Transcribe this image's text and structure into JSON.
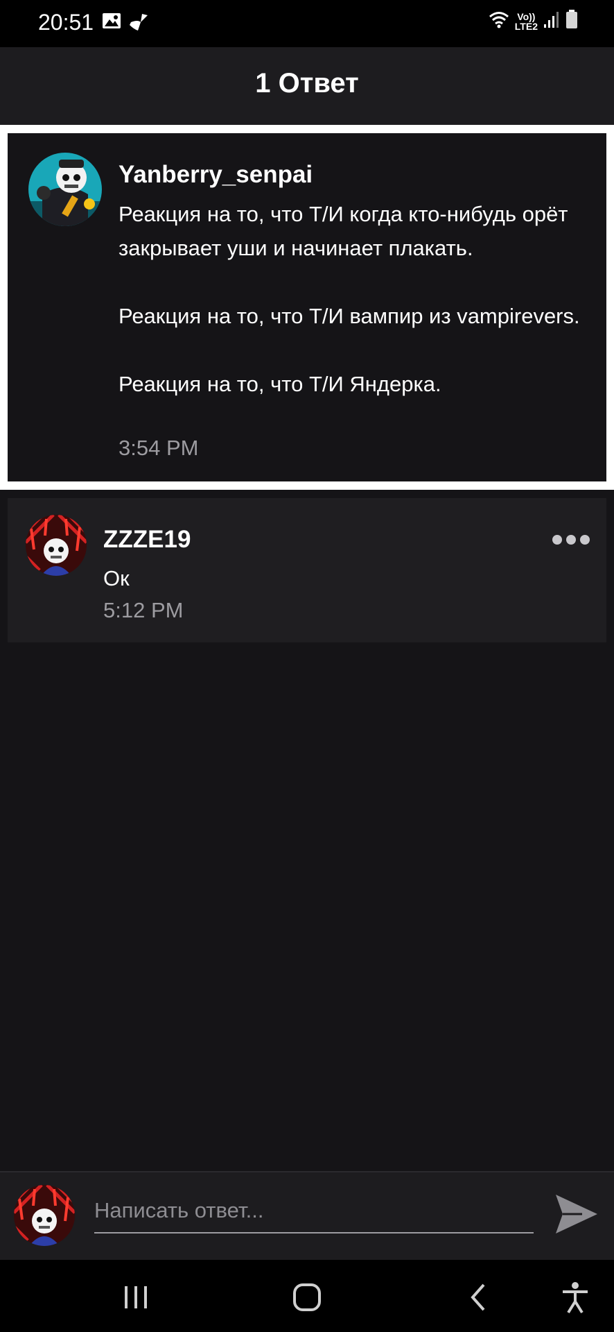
{
  "status_bar": {
    "time": "20:51",
    "left_icons": [
      "image-icon",
      "cleaner-icon"
    ],
    "right_icons": [
      "wifi-icon",
      "volte-indicator",
      "signal-icon",
      "battery-icon"
    ],
    "volte_top": "Vo))",
    "volte_bottom": "LTE2"
  },
  "header": {
    "title": "1 Ответ"
  },
  "parent_comment": {
    "username": "Yanberry_senpai",
    "paragraphs": [
      "Реакция на то, что Т/И когда кто-нибудь орёт закрывает уши и начинает плакать.",
      "Реакция на то, что Т/И вампир из vampirevers.",
      "Реакция на то, что Т/И Яндерка."
    ],
    "time": "3:54 PM"
  },
  "reply": {
    "username": "ZZZE19",
    "text": "Ок",
    "time": "5:12 PM",
    "more_icon": "more-horizontal-icon"
  },
  "composer": {
    "placeholder": "Написать ответ...",
    "value": "",
    "send_icon": "send-icon"
  },
  "nav_bar": {
    "buttons": [
      "recents-icon",
      "home-icon",
      "back-icon",
      "accessibility-icon"
    ]
  },
  "colors": {
    "background": "#151417",
    "card": "#1f1e21",
    "header": "#1d1c1f",
    "muted_text": "#9d9ca1",
    "highlight_border": "#ffffff"
  }
}
